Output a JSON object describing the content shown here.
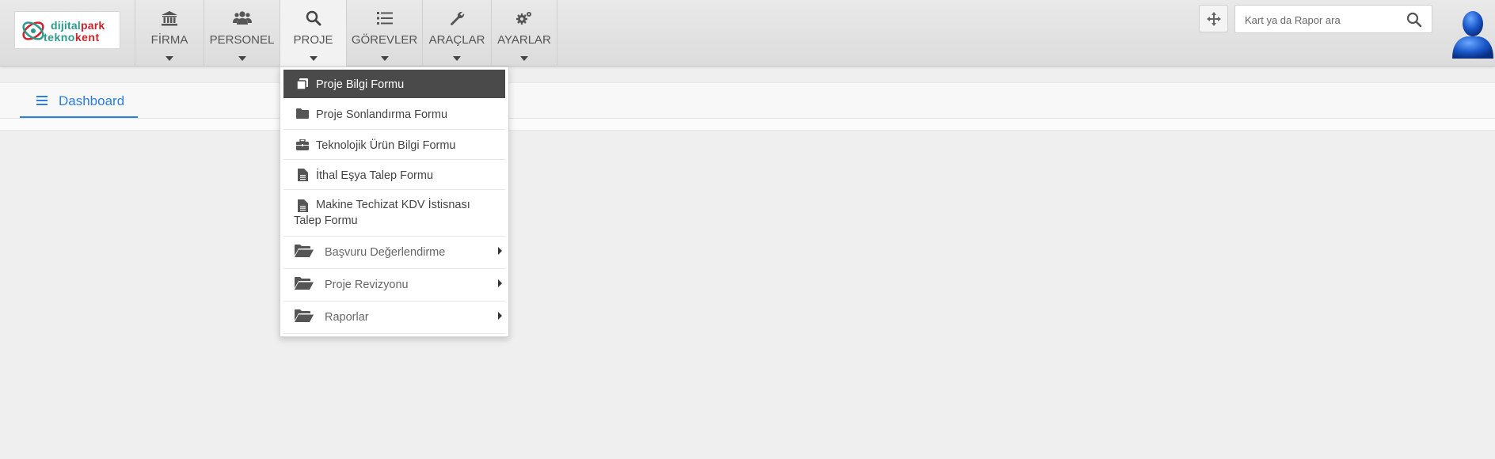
{
  "logo": {
    "line1_a": "dijital",
    "line1_b": "park",
    "line2_a": "tekno",
    "line2_b": "kent"
  },
  "nav": [
    {
      "label": "FİRMA",
      "icon": "bank-icon"
    },
    {
      "label": "PERSONEL",
      "icon": "users-icon"
    },
    {
      "label": "PROJE",
      "icon": "search-icon",
      "active": true
    },
    {
      "label": "GÖREVLER",
      "icon": "list-icon"
    },
    {
      "label": "ARAÇLAR",
      "icon": "wrench-icon"
    },
    {
      "label": "AYARLAR",
      "icon": "cogs-icon"
    }
  ],
  "search": {
    "placeholder": "Kart ya da Rapor ara",
    "value": ""
  },
  "tabs": [
    {
      "label": "Dashboard",
      "icon": "bars-icon",
      "active": true
    }
  ],
  "dropdown": {
    "items": [
      {
        "label": "Proje Bilgi Formu",
        "icon": "clone-icon",
        "active": true
      },
      {
        "label": "Proje Sonlandırma Formu",
        "icon": "folder-icon"
      },
      {
        "label": "Teknolojik Ürün Bilgi Formu",
        "icon": "briefcase-icon"
      },
      {
        "label": "İthal Eşya Talep Formu",
        "icon": "file-icon"
      },
      {
        "label": "Makine Techizat KDV İstisnası Talep Formu",
        "icon": "file-icon"
      }
    ],
    "submenus": [
      {
        "label": "Başvuru Değerlendirme",
        "icon": "folder-open-icon"
      },
      {
        "label": "Proje Revizyonu",
        "icon": "folder-open-icon"
      },
      {
        "label": "Raporlar",
        "icon": "folder-open-icon"
      }
    ]
  },
  "colors": {
    "accent": "#2a7de1",
    "active_item_bg": "#4a4a4a",
    "logo_teal": "#2a9a8c",
    "logo_red": "#d1202a"
  }
}
